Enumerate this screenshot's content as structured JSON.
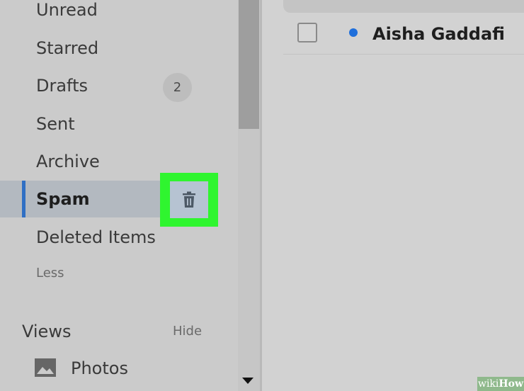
{
  "sidebar": {
    "folders": [
      {
        "label": "Unread"
      },
      {
        "label": "Starred"
      },
      {
        "label": "Drafts",
        "badge": "2"
      },
      {
        "label": "Sent"
      },
      {
        "label": "Archive"
      },
      {
        "label": "Spam",
        "selected": true,
        "action_icon": "trash-icon"
      },
      {
        "label": "Deleted Items"
      }
    ],
    "less_label": "Less",
    "views": {
      "title": "Views",
      "hide_label": "Hide",
      "items": [
        {
          "label": "Photos",
          "icon": "image-icon"
        }
      ]
    }
  },
  "message_list": {
    "rows": [
      {
        "sender": "Aisha Gaddafi",
        "unread": true
      }
    ]
  },
  "colors": {
    "accent": "#2f6fc4",
    "highlight": "#2ff52f",
    "unread_dot": "#1f6fdb"
  },
  "watermark": {
    "prefix": "wiki",
    "suffix": "How"
  }
}
